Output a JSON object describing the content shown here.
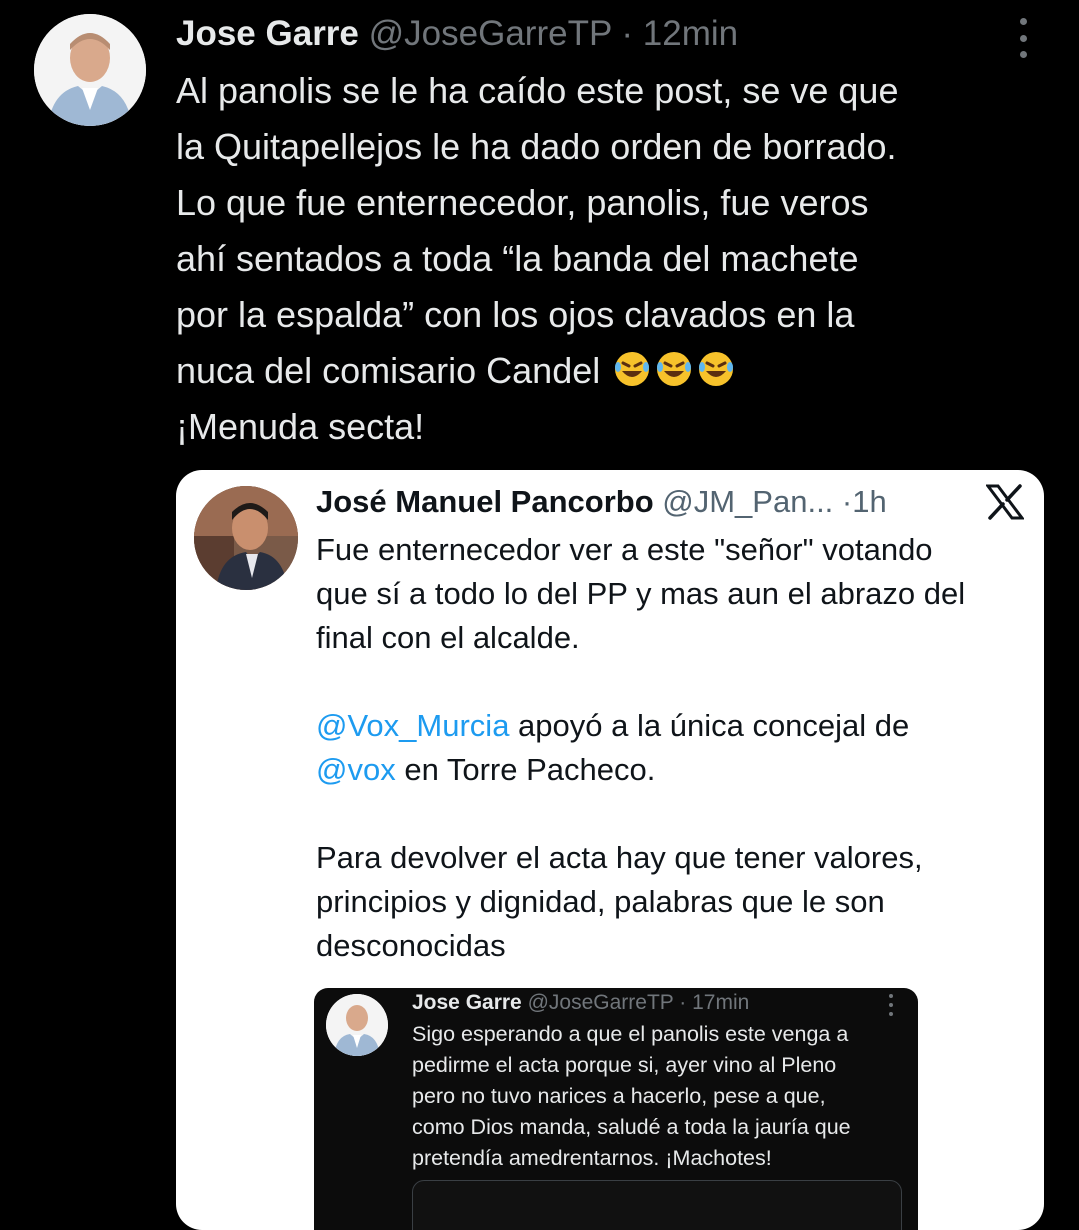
{
  "tweet": {
    "author_name": "Jose Garre",
    "author_handle": "@JoseGarreTP",
    "separator": "·",
    "time": "12min",
    "lines": [
      "Al panolis se le ha caído este post, se ve que",
      "la Quitapellejos le ha dado orden de borrado.",
      "Lo que fue enternecedor, panolis, fue veros",
      "ahí sentados a toda  “la banda del machete",
      "por la espalda” con los ojos clavados en la",
      "nuca del comisario Candel",
      "¡Menuda secta!"
    ],
    "emoji": "rolling-on-the-floor-laughing",
    "emoji_count": 3
  },
  "quoted": {
    "author_name": "José Manuel Pancorbo",
    "author_handle": "@JM_Pan...",
    "separator": "·",
    "time": "1h",
    "logo": "x-logo",
    "para1": [
      "Fue enternecedor ver a este \"señor\" votando",
      "que sí a todo lo del PP y mas aun el abrazo del",
      "final con el alcalde."
    ],
    "mention1": "@Vox_Murcia",
    "line4_rest": " apoyó a la única concejal de",
    "mention2": "@vox",
    "line5_rest": " en Torre Pacheco.",
    "para3": [
      "Para devolver el acta hay que tener valores,",
      "principios y dignidad, palabras que le son",
      "desconocidas"
    ],
    "nested": {
      "author_name": "Jose Garre",
      "author_handle": "@JoseGarreTP",
      "separator": "·",
      "time": "17min",
      "lines": [
        "Sigo esperando a que el panolis este venga a",
        "pedirme el acta porque si, ayer vino al Pleno",
        "pero no tuvo narices a hacerlo, pese a que,",
        "como Dios manda, saludé a toda la jauría que",
        "pretendía amedrentarnos. ¡Machotes!"
      ]
    }
  }
}
